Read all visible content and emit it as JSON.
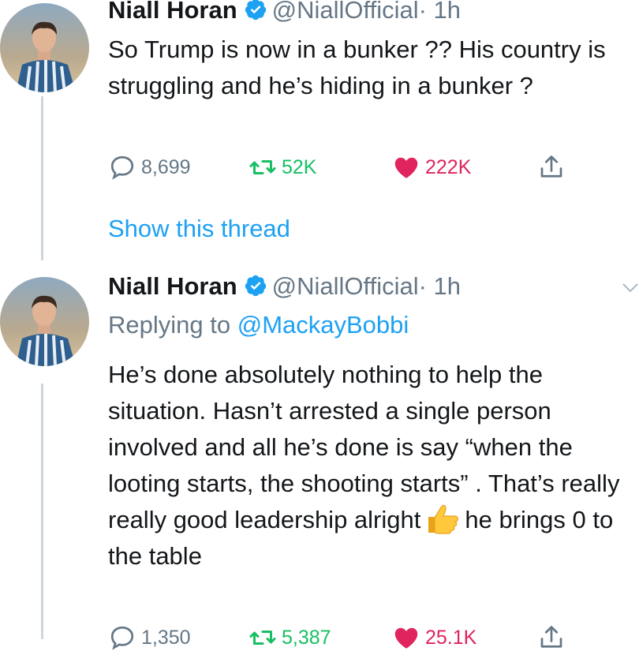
{
  "tweets": [
    {
      "name": "Niall Horan",
      "handle": "@NiallOfficial",
      "time": "· 1h",
      "text": "So Trump is now in a bunker ?? His country is struggling and he’s hiding in a bunker ?",
      "replies": "8,699",
      "retweets": "52K",
      "likes": "222K"
    },
    {
      "name": "Niall Horan",
      "handle": "@NiallOfficial",
      "time": "· 1h",
      "replying_label": "Replying to",
      "replying_to": "@MackayBobbi",
      "text_before_emoji": "He’s done absolutely nothing to help the situation. Hasn’t arrested a single person involved and all he’s done is say “when the looting starts, the shooting starts” . That’s really really good leadership alright",
      "text_after_emoji": "he brings 0 to the table",
      "replies": "1,350",
      "retweets": "5,387",
      "likes": "25.1K"
    }
  ],
  "show_thread": "Show this thread",
  "colors": {
    "accent": "#1da1f2",
    "retweet": "#17bf63",
    "like": "#e0245e",
    "muted": "#657786"
  }
}
